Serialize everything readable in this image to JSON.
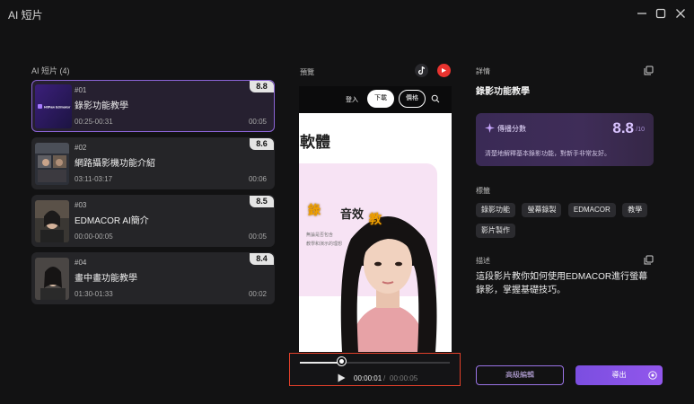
{
  "app": {
    "title": "AI 短片"
  },
  "clips": {
    "title": "AI 短片 (4)",
    "items": [
      {
        "number": "#01",
        "name": "錄影功能教學",
        "range": "00:25-00:31",
        "duration": "00:05",
        "score": "8.8",
        "thumb_text": "HitPaw Edimakor"
      },
      {
        "number": "#02",
        "name": "網路攝影機功能介紹",
        "range": "03:11-03:17",
        "duration": "00:06",
        "score": "8.6"
      },
      {
        "number": "#03",
        "name": "EDMACOR AI簡介",
        "range": "00:00-00:05",
        "duration": "00:05",
        "score": "8.5"
      },
      {
        "number": "#04",
        "name": "畫中畫功能教學",
        "range": "01:30-01:33",
        "duration": "00:02",
        "score": "8.4"
      }
    ]
  },
  "preview": {
    "label": "預覽",
    "nav_login": "登入",
    "nav_download": "下載",
    "nav_price": "價格",
    "headline": "軟體",
    "card_big": "音效",
    "card_small_1": "無論是否包含",
    "card_small_2": "教學和演示的理想",
    "caption_1": "錄",
    "caption_2": "教",
    "player": {
      "current": "00:00:01",
      "separator": "/",
      "total": "00:00:05",
      "progress": 0.28
    }
  },
  "details": {
    "title": "詳情",
    "name": "錄影功能教學",
    "score_label": "傳播分數",
    "score": "8.8",
    "score_max": "/10",
    "score_desc": "清楚地解釋基本錄影功能，對新手非常友好。",
    "tags_title": "標籤",
    "tags": [
      "錄影功能",
      "螢幕錄製",
      "EDMACOR",
      "教學",
      "影片製作"
    ],
    "desc_title": "描述",
    "desc_text": "這段影片教你如何使用EDMACOR進行螢幕錄影，掌握基礎技巧。"
  },
  "buttons": {
    "advanced": "高級編輯",
    "export": "導出"
  },
  "colors": {
    "accent": "#8b5cf6",
    "background": "#121213",
    "highlight": "#e3402a"
  }
}
